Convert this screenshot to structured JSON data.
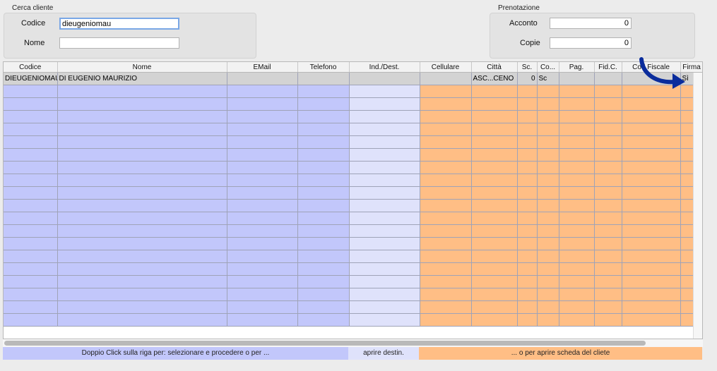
{
  "cerca": {
    "title": "Cerca cliente",
    "codice_label": "Codice",
    "codice_value": "dieugeniomau",
    "nome_label": "Nome",
    "nome_value": ""
  },
  "prenotazione": {
    "title": "Prenotazione",
    "acconto_label": "Acconto",
    "acconto_value": "0",
    "copie_label": "Copie",
    "copie_value": "0"
  },
  "table": {
    "columns": [
      "Codice",
      "Nome",
      "EMail",
      "Telefono",
      "Ind./Dest.",
      "Cellulare",
      "Città",
      "Sc.",
      "Co...",
      "Pag.",
      "Fid.C.",
      "Cod.Fiscale",
      "Firma"
    ],
    "rows": [
      [
        "DIEUGENIOMAU",
        "DI EUGENIO MAURIZIO",
        "",
        "",
        "",
        "",
        "ASC...CENO",
        "0",
        "Sc",
        "",
        "",
        "",
        "Sì"
      ]
    ]
  },
  "hints": {
    "left": "Doppio Click sulla riga per: selezionare e procedere o per ...",
    "middle": "aprire destin.",
    "right": "... o per aprire scheda del cliete"
  },
  "colors": {
    "blue_zone": "#c2c7fb",
    "light_zone": "#dfe2fb",
    "orange_zone": "#ffbe85",
    "arrow": "#0a2c9c"
  }
}
